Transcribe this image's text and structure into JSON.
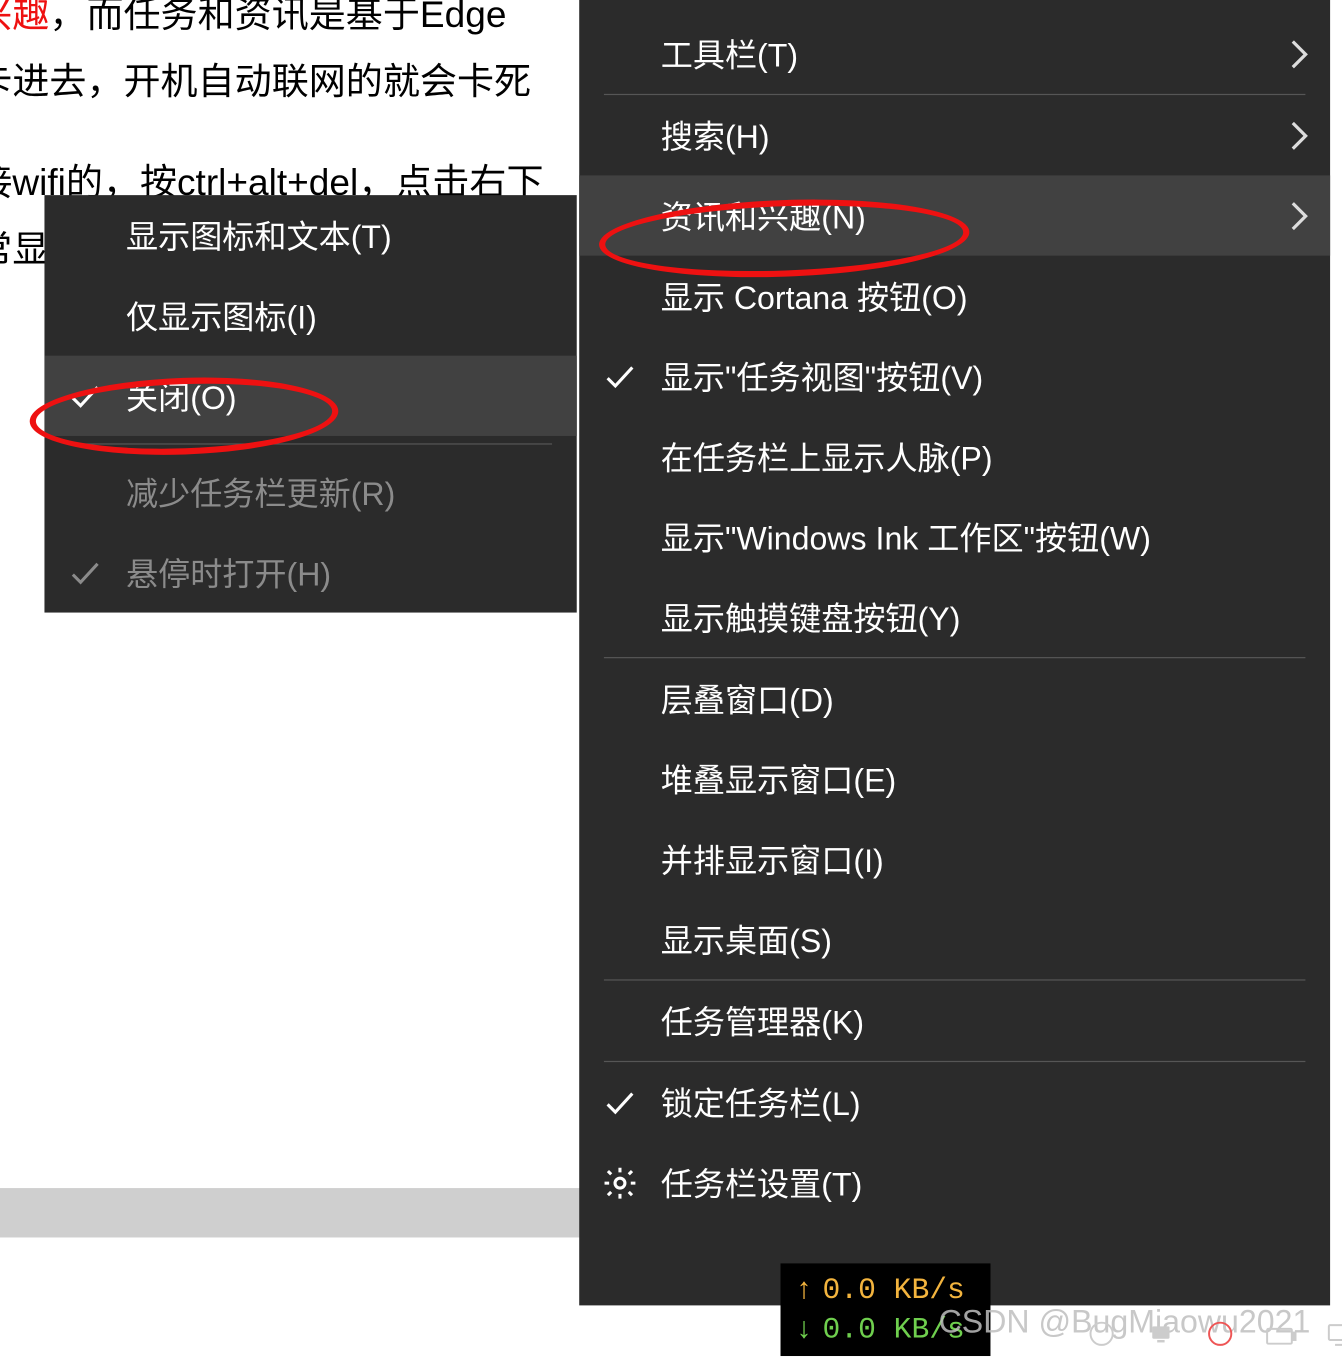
{
  "background": {
    "line1_red": "兴趣",
    "line1_rest": "，而任务和资讯是基于Edge",
    "line2": "卡进去，开机自动联网的就会卡死",
    "line3_a": "接wifi的，按ctrl+alt+del，点击右下",
    "line3_b": "常显"
  },
  "submenu": {
    "items": [
      {
        "label": "显示图标和文本(T)",
        "checked": false,
        "disabled": false
      },
      {
        "label": "仅显示图标(I)",
        "checked": false,
        "disabled": false
      },
      {
        "label": "关闭(O)",
        "checked": true,
        "disabled": false,
        "highlight": true
      }
    ],
    "items2": [
      {
        "label": "减少任务栏更新(R)",
        "checked": false,
        "disabled": true
      },
      {
        "label": "悬停时打开(H)",
        "checked": true,
        "disabled": true
      }
    ]
  },
  "mainmenu": {
    "group1": [
      {
        "label": "工具栏(T)",
        "arrow": true
      },
      {
        "label": "搜索(H)",
        "arrow": true
      },
      {
        "label": "资讯和兴趣(N)",
        "arrow": true,
        "highlight": true
      },
      {
        "label": "显示 Cortana 按钮(O)"
      },
      {
        "label": "显示\"任务视图\"按钮(V)",
        "checked": true
      },
      {
        "label": "在任务栏上显示人脉(P)"
      },
      {
        "label": "显示\"Windows Ink 工作区\"按钮(W)"
      },
      {
        "label": "显示触摸键盘按钮(Y)"
      }
    ],
    "group2": [
      {
        "label": "层叠窗口(D)"
      },
      {
        "label": "堆叠显示窗口(E)"
      },
      {
        "label": "并排显示窗口(I)"
      },
      {
        "label": "显示桌面(S)"
      }
    ],
    "group3": [
      {
        "label": "任务管理器(K)"
      }
    ],
    "group4": [
      {
        "label": "锁定任务栏(L)",
        "checked": true
      },
      {
        "label": "任务栏设置(T)",
        "gear": true
      }
    ]
  },
  "netspeed": {
    "up": "0.0 KB/s",
    "down": "0.0 KB/s"
  },
  "watermark": "CSDN @BugMiaowu2021"
}
